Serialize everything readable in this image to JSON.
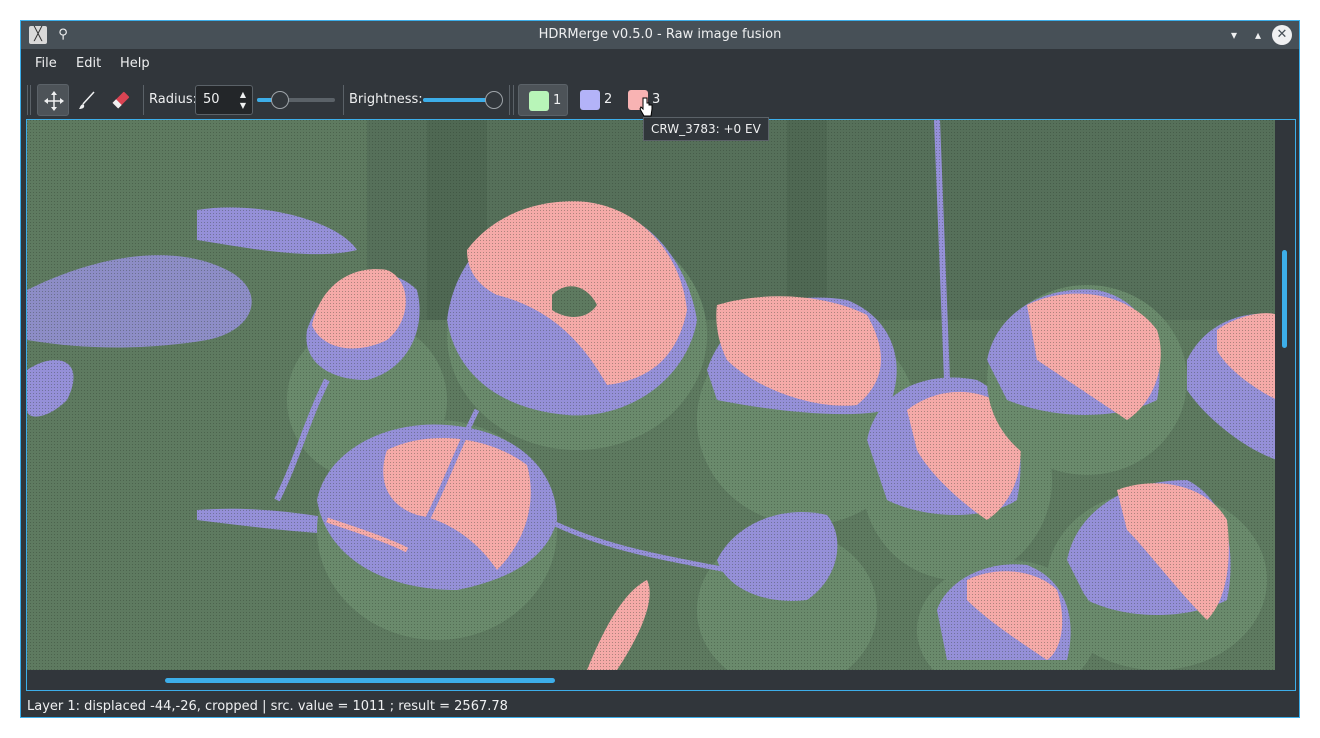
{
  "window": {
    "title": "HDRMerge v0.5.0 - Raw image fusion",
    "app_icon": "hdrmerge-app-icon",
    "pin_icon": "pin-icon",
    "buttons": {
      "minimize": "▾",
      "maximize": "▴",
      "close": "✕"
    }
  },
  "menubar": {
    "items": [
      "File",
      "Edit",
      "Help"
    ]
  },
  "toolbar": {
    "tools": [
      {
        "name": "move-tool",
        "icon": "move-arrows-icon",
        "active": true
      },
      {
        "name": "brush-tool",
        "icon": "brush-icon",
        "active": false
      },
      {
        "name": "eraser-tool",
        "icon": "eraser-icon",
        "active": false
      }
    ],
    "radius_label": "Radius:",
    "radius_value": "50",
    "radius_slider_fraction": 0.3,
    "brightness_label": "Brightness:",
    "brightness_slider_fraction": 1.0,
    "layers": [
      {
        "label": "1",
        "color": "#b8f5b8",
        "active": true
      },
      {
        "label": "2",
        "color": "#b3b3f8",
        "active": false
      },
      {
        "label": "3",
        "color": "#f8b3b3",
        "active": false
      }
    ]
  },
  "tooltip": {
    "text": "CRW_3783: +0 EV"
  },
  "statusbar": {
    "text": "Layer 1: displaced -44,-26, cropped | src. value = 1011 ; result = 2567.78"
  },
  "colors": {
    "accent": "#3daee9",
    "layer_green": "#5e7a60",
    "layer_blue": "#9590d8",
    "layer_red": "#f5aaa8"
  }
}
